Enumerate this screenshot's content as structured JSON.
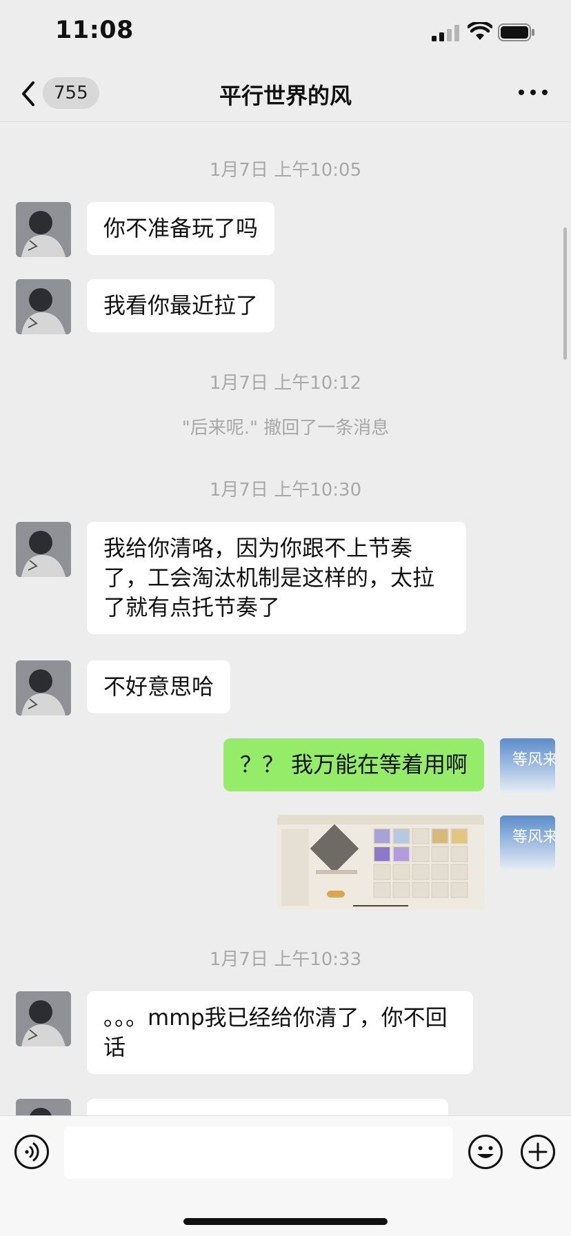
{
  "status_bar": {
    "time": "11:08",
    "signal_icon": "cellular-signal-icon",
    "wifi_icon": "wifi-icon",
    "battery_icon": "battery-icon"
  },
  "nav": {
    "back_icon": "chevron-left-icon",
    "back_badge": "755",
    "title": "平行世界的风",
    "more_icon": "ellipsis-icon"
  },
  "messages": {
    "t1": "1月7日 上午10:05",
    "m1": "你不准备玩了吗",
    "m2": "我看你最近拉了",
    "t2": "1月7日 上午10:12",
    "recall": "\"后来呢.\" 撤回了一条消息",
    "t3": "1月7日 上午10:30",
    "m3": "我给你清咯，因为你跟不上节奏了，工会淘汰机制是这样的，太拉了就有点托节奏了",
    "m4": "不好意思哈",
    "m5": "？？ 我万能在等着用啊",
    "t4": "1月7日 上午10:33",
    "m6": "。。。mmp我已经给你清了，你不回话"
  },
  "my_avatar_text": "等风来",
  "input_bar": {
    "voice_icon": "voice-icon",
    "emoji_icon": "emoji-icon",
    "plus_icon": "plus-circle-icon",
    "input_value": ""
  },
  "colors": {
    "background": "#ededed",
    "incoming_bubble": "#ffffff",
    "outgoing_bubble": "#95ec69",
    "timestamp": "#a8a8a8"
  }
}
